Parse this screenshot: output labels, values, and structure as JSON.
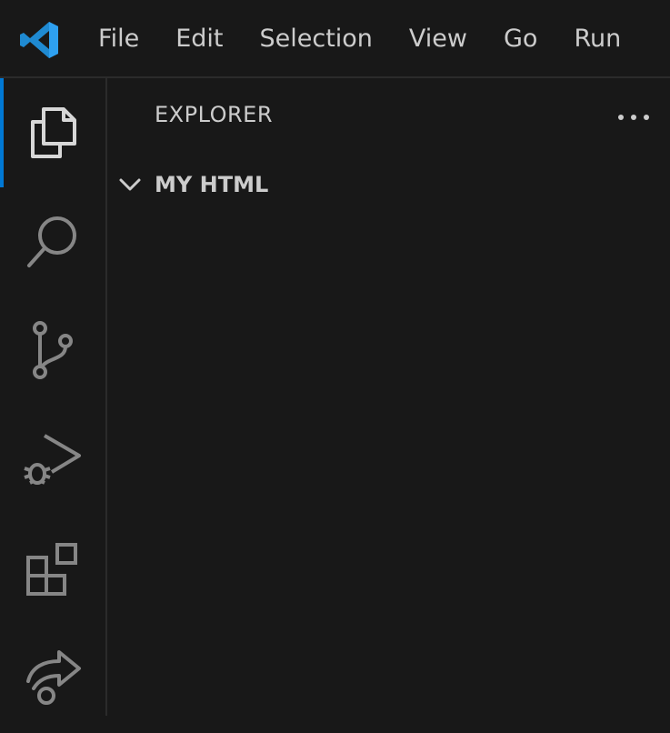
{
  "titlebar": {
    "logo": "vscode-logo",
    "menu": [
      "File",
      "Edit",
      "Selection",
      "View",
      "Go",
      "Run"
    ]
  },
  "activitybar": {
    "items": [
      {
        "icon": "explorer-icon",
        "active": true
      },
      {
        "icon": "search-icon",
        "active": false
      },
      {
        "icon": "source-control-icon",
        "active": false
      },
      {
        "icon": "run-and-debug-icon",
        "active": false
      },
      {
        "icon": "extensions-icon",
        "active": false
      },
      {
        "icon": "remote-share-icon",
        "active": false
      }
    ]
  },
  "sidebar": {
    "title": "EXPLORER",
    "folder": "MY HTML"
  },
  "colors": {
    "background": "#181818",
    "text": "#cccccc",
    "accent": "#0078d4",
    "border": "#2b2b2b"
  }
}
